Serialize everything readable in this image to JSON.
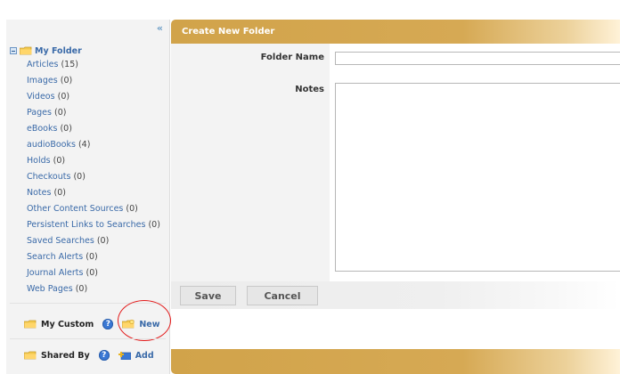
{
  "sidebar": {
    "collapse_label": "«",
    "tree": {
      "root_label": "My Folder",
      "items": [
        {
          "label": "Articles",
          "count": "(15)"
        },
        {
          "label": "Images",
          "count": "(0)"
        },
        {
          "label": "Videos",
          "count": "(0)"
        },
        {
          "label": "Pages",
          "count": "(0)"
        },
        {
          "label": "eBooks",
          "count": "(0)"
        },
        {
          "label": "audioBooks",
          "count": "(4)"
        },
        {
          "label": "Holds",
          "count": "(0)"
        },
        {
          "label": "Checkouts",
          "count": "(0)"
        },
        {
          "label": "Notes",
          "count": "(0)"
        },
        {
          "label": "Other Content Sources",
          "count": "(0)"
        },
        {
          "label": "Persistent Links to Searches",
          "count": "(0)"
        },
        {
          "label": "Saved Searches",
          "count": "(0)"
        },
        {
          "label": "Search Alerts",
          "count": "(0)"
        },
        {
          "label": "Journal Alerts",
          "count": "(0)"
        },
        {
          "label": "Web Pages",
          "count": "(0)"
        }
      ]
    },
    "my_custom": {
      "label": "My Custom",
      "help": "?",
      "action_label": "New"
    },
    "shared_by": {
      "label": "Shared By",
      "help": "?",
      "action_label": "Add"
    }
  },
  "panel": {
    "title": "Create New Folder",
    "folder_name_label": "Folder Name",
    "notes_label": "Notes",
    "folder_name_value": "",
    "notes_value": "",
    "save_label": "Save",
    "cancel_label": "Cancel"
  },
  "colors": {
    "header_gold": "#d1a34a",
    "link_blue": "#3a6aa8",
    "highlight_red": "#e31b1b"
  }
}
